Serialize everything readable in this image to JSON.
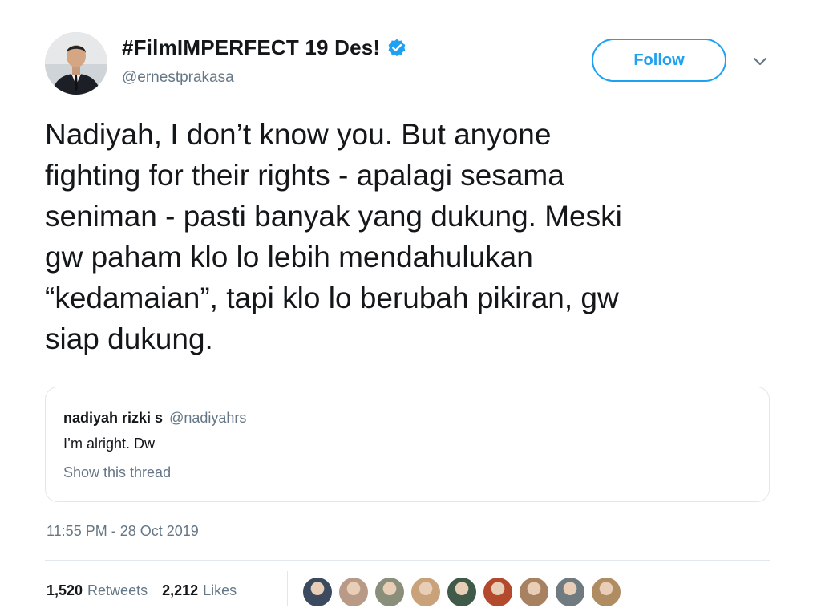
{
  "author": {
    "display_name": "#FilmIMPERFECT 19 Des!",
    "handle": "@ernestprakasa",
    "avatar_icon": "profile-photo-man-in-suit",
    "verified_icon": "verified-badge-icon"
  },
  "actions": {
    "follow_label": "Follow",
    "menu_icon": "chevron-down-icon"
  },
  "tweet": {
    "lines": [
      "Nadiyah, I don’t know you. But anyone",
      "fighting for their rights - apalagi sesama",
      "seniman - pasti banyak yang dukung. Meski",
      "gw paham klo lo lebih mendahulukan",
      "“kedamaian”, tapi klo lo berubah pikiran, gw",
      "siap dukung."
    ]
  },
  "quoted": {
    "name": "nadiyah rizki s",
    "handle": "@nadiyahrs",
    "text": "I’m alright. Dw",
    "thread_link": "Show this thread"
  },
  "meta": {
    "timestamp": "11:55 PM - 28 Oct 2019"
  },
  "stats": {
    "retweets_count": "1,520",
    "retweets_label": "Retweets",
    "likes_count": "2,212",
    "likes_label": "Likes"
  },
  "likers": [
    {
      "icon": "liker-avatar-icon",
      "color": "#3b4a5e"
    },
    {
      "icon": "liker-avatar-icon",
      "color": "#b89a86"
    },
    {
      "icon": "liker-avatar-icon",
      "color": "#8a8f7c"
    },
    {
      "icon": "liker-avatar-icon",
      "color": "#c9a27a"
    },
    {
      "icon": "liker-avatar-icon",
      "color": "#3f5a48"
    },
    {
      "icon": "liker-avatar-icon",
      "color": "#b34a2e"
    },
    {
      "icon": "liker-avatar-icon",
      "color": "#a88260"
    },
    {
      "icon": "liker-avatar-icon",
      "color": "#6f7b80"
    },
    {
      "icon": "liker-avatar-icon",
      "color": "#b08c62"
    }
  ],
  "colors": {
    "accent": "#1da1f2",
    "text_primary": "#14171a",
    "text_secondary": "#657786",
    "border": "#e1e8ed"
  }
}
